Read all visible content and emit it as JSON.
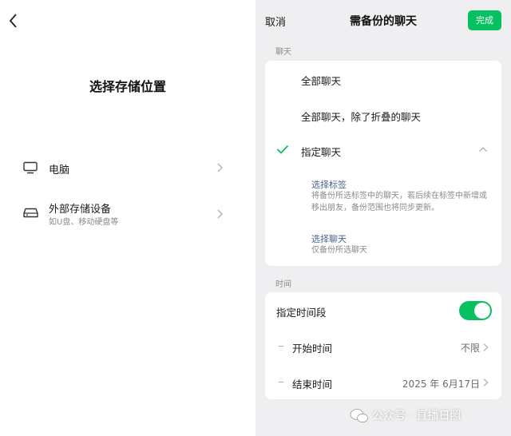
{
  "left": {
    "title": "选择存储位置",
    "options": [
      {
        "label": "电脑",
        "icon": "monitor-icon"
      },
      {
        "label": "外部存储设备",
        "sub": "如U盘、移动硬盘等",
        "icon": "drive-icon"
      }
    ]
  },
  "right": {
    "header": {
      "cancel": "取消",
      "title": "需备份的聊天",
      "done": "完成"
    },
    "chat_section_label": "聊天",
    "chat_options": [
      {
        "label": "全部聊天"
      },
      {
        "label": "全部聊天，除了折叠的聊天"
      },
      {
        "label": "指定聊天",
        "selected": true
      }
    ],
    "sub_options": [
      {
        "title": "选择标签",
        "desc": "将备份所选标签中的聊天，若后续在标签中新增或移出朋友，备份范围也将同步更新。"
      },
      {
        "title": "选择聊天",
        "desc": "仅备份所选聊天"
      }
    ],
    "time_section_label": "时间",
    "time": {
      "toggle_label": "指定时间段",
      "toggle_on": true,
      "start_label": "开始时间",
      "start_value": "不限",
      "end_label": "结束时间",
      "end_value": "2025 年 6月17日"
    }
  },
  "watermark": "公众号 · 直播日照",
  "colors": {
    "accent": "#07c160",
    "link": "#4a6290",
    "panel_bg": "#efeff1"
  }
}
